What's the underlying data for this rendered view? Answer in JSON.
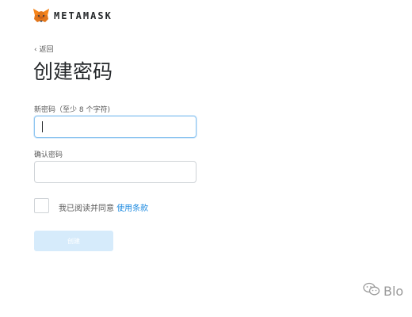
{
  "brand": {
    "logo_icon": "fox-logo-icon",
    "name": "METAMASK",
    "accent": "#f6851b"
  },
  "nav": {
    "back_label": "‹ 返回"
  },
  "form": {
    "title": "创建密码",
    "new_password": {
      "label": "新密码（至少 8 个字符)",
      "value": ""
    },
    "confirm_password": {
      "label": "确认密码",
      "value": ""
    },
    "terms": {
      "checked": false,
      "text": "我已阅读并同意",
      "link_label": "使用条款",
      "link_color": "#1f8be0"
    },
    "submit": {
      "label": "创建",
      "enabled": false,
      "color": "#d6ebfb"
    }
  },
  "watermark": {
    "icon": "wechat-icon",
    "text": "Blo"
  }
}
